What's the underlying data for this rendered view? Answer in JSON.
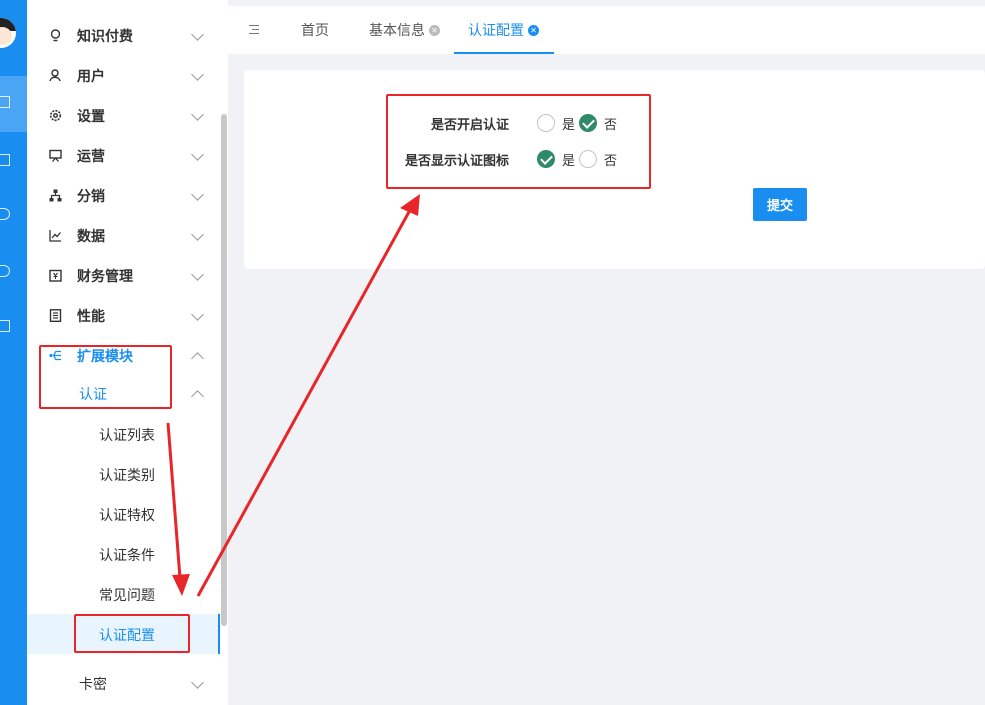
{
  "sidebar": {
    "items": [
      {
        "label": "知识付费",
        "icon": "lightbulb-icon"
      },
      {
        "label": "用户",
        "icon": "user-icon"
      },
      {
        "label": "设置",
        "icon": "gear-icon"
      },
      {
        "label": "运营",
        "icon": "presentation-icon"
      },
      {
        "label": "分销",
        "icon": "org-chart-icon"
      },
      {
        "label": "数据",
        "icon": "line-chart-icon"
      },
      {
        "label": "财务管理",
        "icon": "finance-icon"
      },
      {
        "label": "性能",
        "icon": "document-icon"
      },
      {
        "label": "扩展模块",
        "icon": "extension-icon"
      }
    ],
    "submenu_label": "认证",
    "subitems": [
      "认证列表",
      "认证类别",
      "认证特权",
      "认证条件",
      "常见问题",
      "认证配置"
    ],
    "bottom_item": "卡密",
    "active_subitem": "认证配置"
  },
  "tabs": [
    {
      "label": "首页",
      "closable": false
    },
    {
      "label": "基本信息",
      "closable": true
    },
    {
      "label": "认证配置",
      "closable": true,
      "active": true
    }
  ],
  "form": {
    "fields": [
      {
        "label": "是否开启认证",
        "options": [
          "是",
          "否"
        ],
        "selected": "否"
      },
      {
        "label": "是否显示认证图标",
        "options": [
          "是",
          "否"
        ],
        "selected": "是"
      }
    ],
    "submit_label": "提交"
  },
  "colors": {
    "accent": "#1a8ef0",
    "radio_checked": "#2f8a6a",
    "annotation": "#e8262a"
  }
}
